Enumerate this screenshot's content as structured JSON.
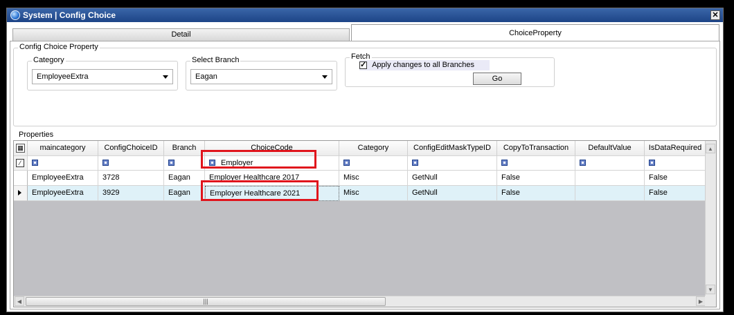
{
  "window": {
    "title": "System | Config Choice",
    "close_glyph": "✕"
  },
  "tabs": [
    {
      "label": "Detail",
      "active": false
    },
    {
      "label": "ChoiceProperty",
      "active": true
    }
  ],
  "config_group": {
    "legend": "Config Choice Property",
    "category": {
      "label": "Category",
      "value": "EmployeeExtra"
    },
    "branch": {
      "label": "Select Branch",
      "value": "Eagan"
    },
    "fetch": {
      "label": "Fetch",
      "apply_all_label": "Apply changes to all Branches",
      "apply_all_checked": true,
      "go_label": "Go"
    }
  },
  "properties": {
    "legend": "Properties",
    "columns": [
      "maincategory",
      "ConfigChoiceID",
      "Branch",
      "ChoiceCode",
      "Category",
      "ConfigEditMaskTypeID",
      "CopyToTransaction",
      "DefaultValue",
      "IsDataRequired"
    ],
    "filter": {
      "choicecode_text": "Employer"
    },
    "rows": [
      {
        "maincategory": "EmployeeExtra",
        "ConfigChoiceID": "3728",
        "Branch": "Eagan",
        "ChoiceCode": "Employer Healthcare 2017",
        "Category": "Misc",
        "ConfigEditMaskTypeID": "GetNull",
        "CopyToTransaction": "False",
        "DefaultValue": "",
        "IsDataRequired": "False",
        "selected": false
      },
      {
        "maincategory": "EmployeeExtra",
        "ConfigChoiceID": "3929",
        "Branch": "Eagan",
        "ChoiceCode": "Employer Healthcare 2021",
        "Category": "Misc",
        "ConfigEditMaskTypeID": "GetNull",
        "CopyToTransaction": "False",
        "DefaultValue": "",
        "IsDataRequired": "False",
        "selected": true
      }
    ]
  },
  "colors": {
    "highlight": "#e0141c",
    "title_bar": "#1d4487",
    "selected_row": "#dff1f8",
    "empty_grid": "#c0c0c4"
  }
}
